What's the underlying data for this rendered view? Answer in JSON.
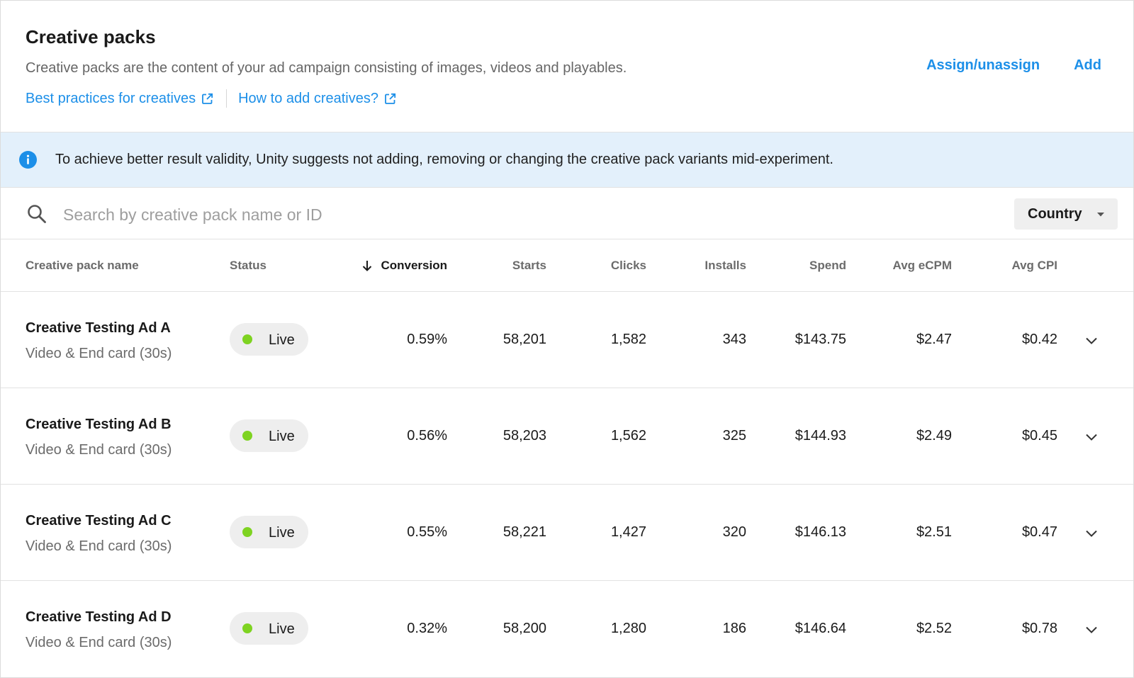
{
  "header": {
    "title": "Creative packs",
    "description": "Creative packs are the content of your ad campaign consisting of images, videos and playables.",
    "links": [
      {
        "label": "Best practices for creatives",
        "icon": "external-link-icon"
      },
      {
        "label": "How to add creatives?",
        "icon": "external-link-icon"
      }
    ],
    "actions": {
      "assign_label": "Assign/unassign",
      "add_label": "Add"
    }
  },
  "banner": {
    "icon": "info-icon",
    "text": "To achieve better result validity, Unity suggests not adding, removing or changing the creative pack variants mid-experiment."
  },
  "search": {
    "placeholder": "Search by creative pack name or ID",
    "value": "",
    "filter_label": "Country"
  },
  "table": {
    "sort": {
      "column": "Conversion",
      "direction": "descending"
    },
    "columns": {
      "name": "Creative pack name",
      "status": "Status",
      "conversion": "Conversion",
      "starts": "Starts",
      "clicks": "Clicks",
      "installs": "Installs",
      "spend": "Spend",
      "ecpm": "Avg eCPM",
      "cpi": "Avg CPI"
    },
    "rows": [
      {
        "name": "Creative Testing Ad A",
        "subtitle": "Video & End card (30s)",
        "status": "Live",
        "conversion": "0.59%",
        "starts": "58,201",
        "clicks": "1,582",
        "installs": "343",
        "spend": "$143.75",
        "ecpm": "$2.47",
        "cpi": "$0.42"
      },
      {
        "name": "Creative Testing Ad B",
        "subtitle": "Video & End card (30s)",
        "status": "Live",
        "conversion": "0.56%",
        "starts": "58,203",
        "clicks": "1,562",
        "installs": "325",
        "spend": "$144.93",
        "ecpm": "$2.49",
        "cpi": "$0.45"
      },
      {
        "name": "Creative Testing Ad C",
        "subtitle": "Video & End card (30s)",
        "status": "Live",
        "conversion": "0.55%",
        "starts": "58,221",
        "clicks": "1,427",
        "installs": "320",
        "spend": "$146.13",
        "ecpm": "$2.51",
        "cpi": "$0.47"
      },
      {
        "name": "Creative Testing Ad D",
        "subtitle": "Video & End card (30s)",
        "status": "Live",
        "conversion": "0.32%",
        "starts": "58,200",
        "clicks": "1,280",
        "installs": "186",
        "spend": "$146.64",
        "ecpm": "$2.52",
        "cpi": "$0.78"
      }
    ]
  },
  "colors": {
    "link": "#1c8fe8",
    "banner_bg": "#e3f0fb",
    "live_dot": "#7ed321",
    "pill_bg": "#eeeeee"
  }
}
